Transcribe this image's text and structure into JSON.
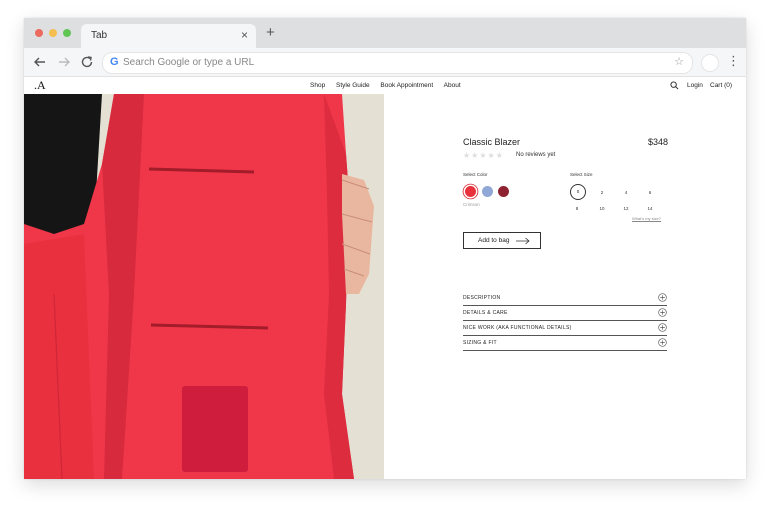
{
  "browser": {
    "tab_title": "Tab",
    "tab_close": "×",
    "new_tab": "+",
    "omnibox_placeholder": "Search Google or type a URL",
    "omnibox_value": "",
    "google_logo": "G",
    "menu_glyph": "⋮",
    "star_glyph": "☆"
  },
  "site": {
    "logo": ".A",
    "nav": [
      "Shop",
      "Style Guide",
      "Book Appointment",
      "About"
    ],
    "login": "Login",
    "cart": "Cart (0)"
  },
  "product": {
    "title": "Classic Blazer",
    "price": "$348",
    "rating_stars": "★★★★★",
    "reviews": "No reviews yet",
    "select_color_label": "Select Color",
    "colors": [
      {
        "name": "Crimson",
        "hex": "#e8313a"
      },
      {
        "name": "",
        "hex": "#8fa8d6"
      },
      {
        "name": "",
        "hex": "#8e2230"
      }
    ],
    "selected_color_name": "Crimson",
    "select_size_label": "Select Size",
    "sizes": [
      "0",
      "2",
      "4",
      "6",
      "8",
      "10",
      "12",
      "14"
    ],
    "selected_size": "0",
    "whats_my_size": "What's my size?",
    "add_to_bag": "Add to bag",
    "accordion": [
      "DESCRIPTION",
      "DETAILS & CARE",
      "NICE WORK (AKA FUNCTIONAL DETAILS)",
      "SIZING & FIT"
    ]
  },
  "colors": {
    "chrome_tabbar": "#dedfe1",
    "chrome_toolbar": "#f5f6f7",
    "blazer_red": "#f0374a",
    "hero_background": "#e5e2d6"
  }
}
